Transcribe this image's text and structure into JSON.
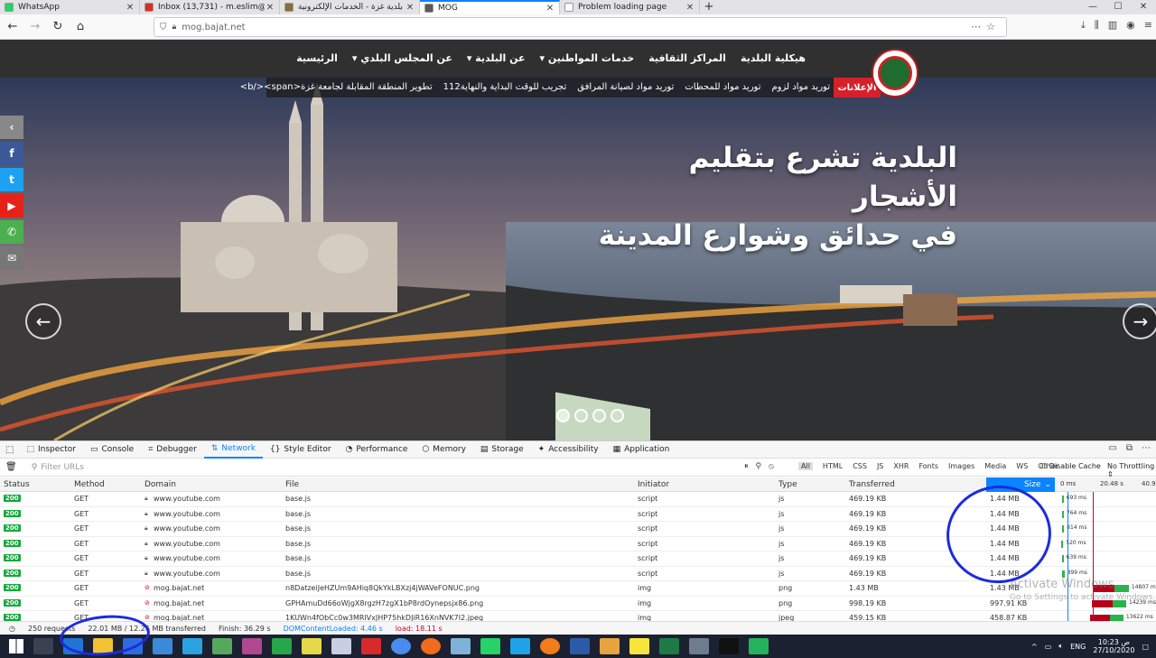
{
  "browser": {
    "tabs": [
      {
        "title": "WhatsApp",
        "favicon_color": "#25d366",
        "active": false
      },
      {
        "title": "Inbox (13,731) - m.eslim@gmai",
        "favicon_color": "#d93025",
        "active": false
      },
      {
        "title": "بلدية غزة - الخدمات الإلكترونية",
        "favicon_color": "#8a6d3b",
        "active": false
      },
      {
        "title": "MOG",
        "favicon_color": "#5a5a5a",
        "active": true
      },
      {
        "title": "Problem loading page",
        "favicon_color": "#ffffff",
        "active": false
      }
    ],
    "url": "mog.bajat.net",
    "new_tab": "+"
  },
  "site": {
    "menu": [
      "الرئيسية",
      "عن المجلس البلدي ▾",
      "عن البلدية ▾",
      "خدمات المواطنين ▾",
      "المراكز الثقافية",
      "هيكلية البلدية"
    ],
    "ticker_label": "الإعلانات",
    "ticker_items": [
      "تطوير المنطقة المقابلة لجامعة غزة<b/><span>",
      "تجريب للوقت البداية والنهاية112",
      "توريد مواد لصيانة المرافق",
      "توريد مواد للمحطات",
      "توريد مواد لزوم"
    ],
    "hero_title_line1": "البلدية تشرع بتقليم الأشجار",
    "hero_title_line2": "في حدائق وشوارع المدينة",
    "social": [
      {
        "icon": "collapse-icon",
        "glyph": "‹",
        "color": "#888888"
      },
      {
        "icon": "facebook-icon",
        "glyph": "f",
        "color": "#3b5998"
      },
      {
        "icon": "twitter-icon",
        "glyph": "t",
        "color": "#1da1f2"
      },
      {
        "icon": "youtube-icon",
        "glyph": "▶",
        "color": "#e62117"
      },
      {
        "icon": "phone-icon",
        "glyph": "✆",
        "color": "#4caf50"
      },
      {
        "icon": "mail-icon",
        "glyph": "✉",
        "color": "#777777"
      }
    ]
  },
  "devtools": {
    "tabs": [
      "Inspector",
      "Console",
      "Debugger",
      "Network",
      "Style Editor",
      "Performance",
      "Memory",
      "Storage",
      "Accessibility",
      "Application"
    ],
    "active_tab": "Network",
    "filter_placeholder": "Filter URLs",
    "type_filters": [
      "All",
      "HTML",
      "CSS",
      "JS",
      "XHR",
      "Fonts",
      "Images",
      "Media",
      "WS",
      "Other"
    ],
    "disable_cache": "Disable Cache",
    "throttling": "No Throttling ⇕",
    "columns": [
      "Status",
      "Method",
      "Domain",
      "File",
      "Initiator",
      "Type",
      "Transferred",
      "Size"
    ],
    "timeline_ticks": [
      "0 ms",
      "20.48 s",
      "40.96"
    ],
    "requests": [
      {
        "status": "200",
        "method": "GET",
        "domain": "www.youtube.com",
        "file": "base.js",
        "initiator": "script",
        "type": "js",
        "transferred": "469.19 KB",
        "size": "1.44 MB",
        "time": "693 ms"
      },
      {
        "status": "200",
        "method": "GET",
        "domain": "www.youtube.com",
        "file": "base.js",
        "initiator": "script",
        "type": "js",
        "transferred": "469.19 KB",
        "size": "1.44 MB",
        "time": "764 ms"
      },
      {
        "status": "200",
        "method": "GET",
        "domain": "www.youtube.com",
        "file": "base.js",
        "initiator": "script",
        "type": "js",
        "transferred": "469.19 KB",
        "size": "1.44 MB",
        "time": "814 ms"
      },
      {
        "status": "200",
        "method": "GET",
        "domain": "www.youtube.com",
        "file": "base.js",
        "initiator": "script",
        "type": "js",
        "transferred": "469.19 KB",
        "size": "1.44 MB",
        "time": "520 ms"
      },
      {
        "status": "200",
        "method": "GET",
        "domain": "www.youtube.com",
        "file": "base.js",
        "initiator": "script",
        "type": "js",
        "transferred": "469.19 KB",
        "size": "1.44 MB",
        "time": "639 ms"
      },
      {
        "status": "200",
        "method": "GET",
        "domain": "www.youtube.com",
        "file": "base.js",
        "initiator": "script",
        "type": "js",
        "transferred": "469.19 KB",
        "size": "1.44 MB",
        "time": "899 ms"
      },
      {
        "status": "200",
        "method": "GET",
        "domain": "mog.bajat.net",
        "file": "n8DatzeiJeHZUm9AHiq8QkYkLBXzj4jWAVeFONUC.png",
        "initiator": "img",
        "type": "png",
        "transferred": "1.43 MB",
        "size": "1.43 MB",
        "time": "14807 ms"
      },
      {
        "status": "200",
        "method": "GET",
        "domain": "mog.bajat.net",
        "file": "GPHAmuDd66oWjgX8rgzH7zgX1bP8rdOynepsjx86.png",
        "initiator": "img",
        "type": "png",
        "transferred": "998.19 KB",
        "size": "997.91 KB",
        "time": "14239 ms"
      },
      {
        "status": "200",
        "method": "GET",
        "domain": "mog.bajat.net",
        "file": "1KUWn4fObCc0w3MRlVxJHP75hkDJiR16XnNVK7I2.jpeg",
        "initiator": "img",
        "type": "jpeg",
        "transferred": "459.15 KB",
        "size": "458.87 KB",
        "time": "13622 ms"
      }
    ],
    "status_bar": {
      "requests": "250 requests",
      "transferred": "22.01 MB / 12.26 MB transferred",
      "finish": "Finish: 36.29 s",
      "dcl": "DOMContentLoaded: 4.46 s",
      "load": "load: 18.11 s"
    },
    "watermark_line1": "Activate Windows",
    "watermark_line2": "Go to Settings to activate Windows."
  },
  "taskbar": {
    "lang": "ENG",
    "time": "10:23 ص",
    "date": "27/10/2020"
  }
}
